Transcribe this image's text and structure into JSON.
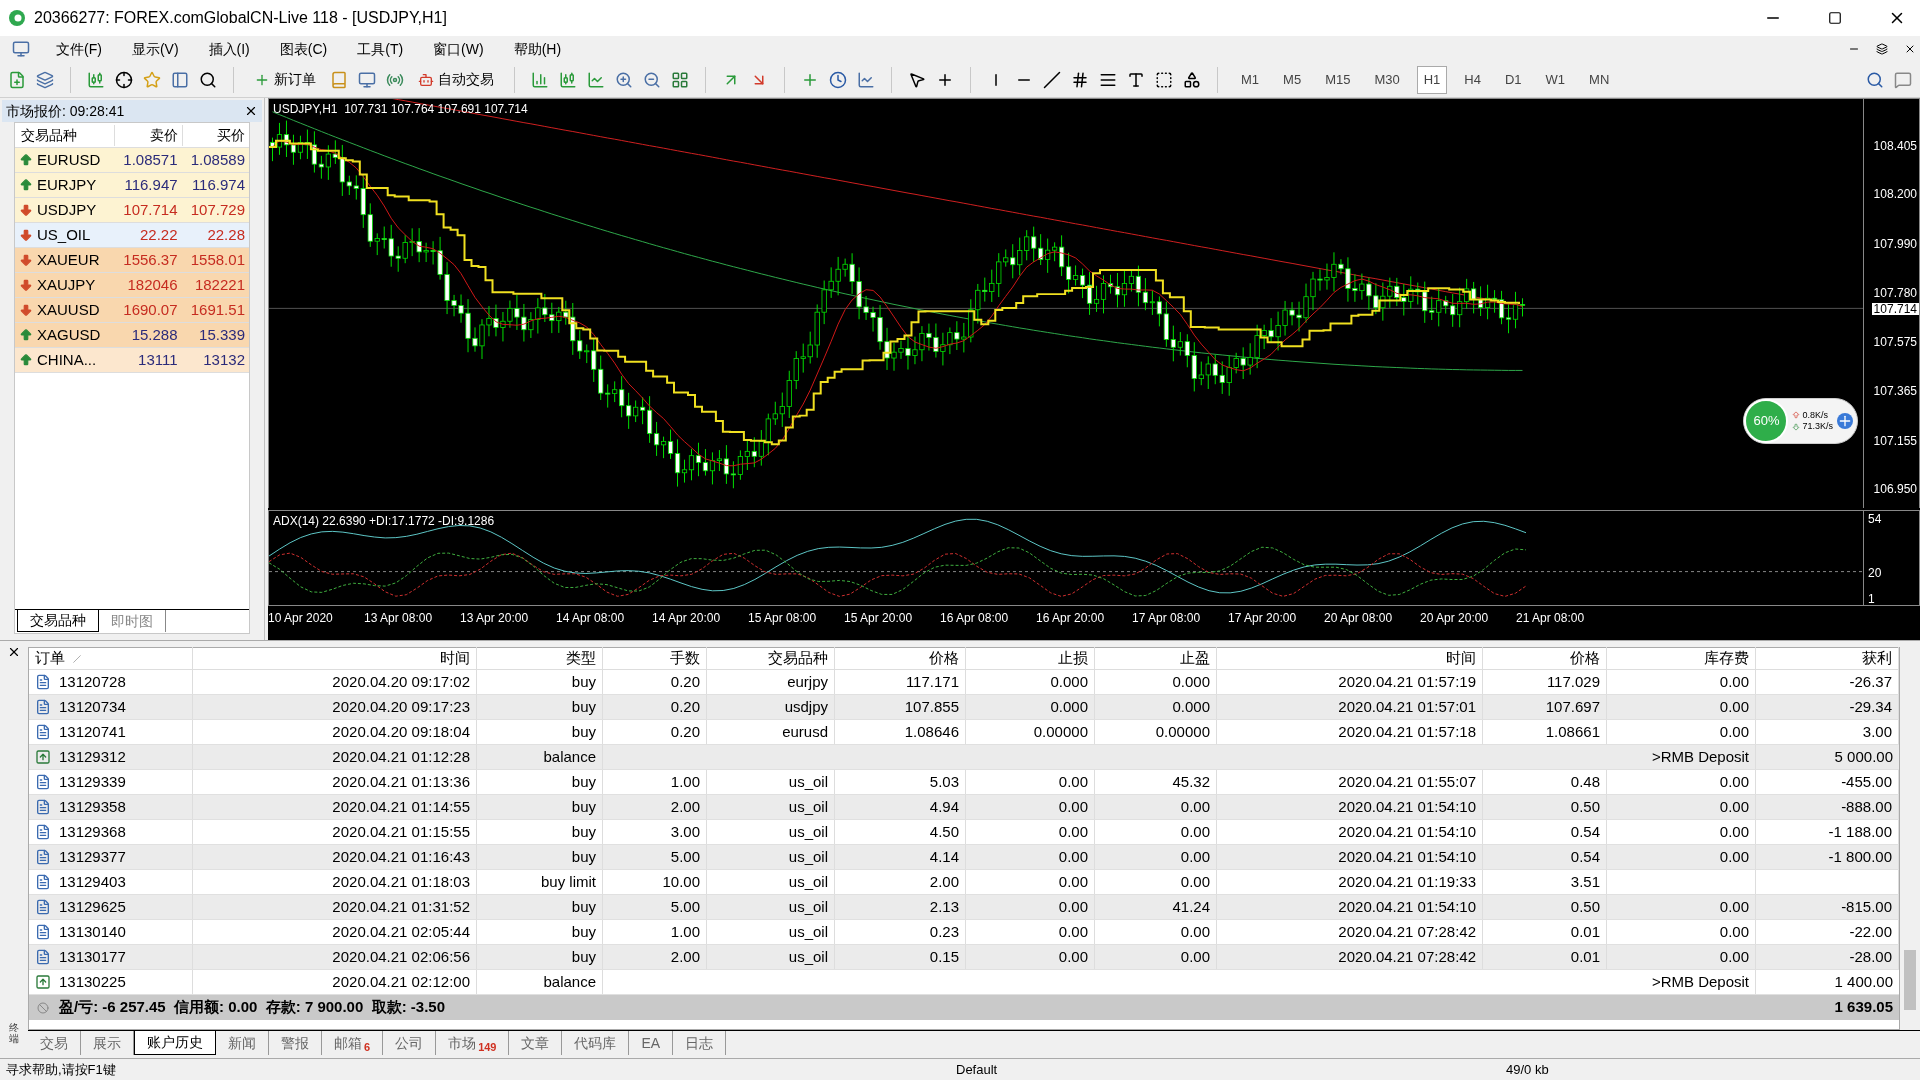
{
  "window": {
    "title": "20366277: FOREX.comGlobalCN-Live 118 - [USDJPY,H1]"
  },
  "menu": [
    "文件(F)",
    "显示(V)",
    "插入(I)",
    "图表(C)",
    "工具(T)",
    "窗口(W)",
    "帮助(H)"
  ],
  "toolbar": {
    "new_order": "新订单",
    "auto_trading": "自动交易",
    "timeframes": [
      {
        "label": "M1",
        "selected": false
      },
      {
        "label": "M5",
        "selected": false
      },
      {
        "label": "M15",
        "selected": false
      },
      {
        "label": "M30",
        "selected": false
      },
      {
        "label": "H1",
        "selected": true
      },
      {
        "label": "H4",
        "selected": false
      },
      {
        "label": "D1",
        "selected": false
      },
      {
        "label": "W1",
        "selected": false
      },
      {
        "label": "MN",
        "selected": false
      }
    ]
  },
  "market_watch": {
    "title": "市场报价: 09:28:41",
    "columns": [
      "交易品种",
      "卖价",
      "买价"
    ],
    "rows": [
      {
        "symbol": "EURUSD",
        "bid": "1.08571",
        "ask": "1.08589",
        "rising": true,
        "color": "#fdf3d2"
      },
      {
        "symbol": "EURJPY",
        "bid": "116.947",
        "ask": "116.974",
        "rising": true,
        "color": "#fdf3d2"
      },
      {
        "symbol": "USDJPY",
        "bid": "107.714",
        "ask": "107.729",
        "rising": false,
        "color": "#fdf3d2"
      },
      {
        "symbol": "US_OIL",
        "bid": "22.22",
        "ask": "22.28",
        "rising": false,
        "color": "#e8f1fb"
      },
      {
        "symbol": "XAUEUR",
        "bid": "1556.37",
        "ask": "1558.01",
        "rising": false,
        "color": "#f9d7ae"
      },
      {
        "symbol": "XAUJPY",
        "bid": "182046",
        "ask": "182221",
        "rising": false,
        "color": "#f9d7ae"
      },
      {
        "symbol": "XAUUSD",
        "bid": "1690.07",
        "ask": "1691.51",
        "rising": false,
        "color": "#f9d7ae"
      },
      {
        "symbol": "XAGUSD",
        "bid": "15.288",
        "ask": "15.339",
        "rising": true,
        "color": "#f9d7ae"
      },
      {
        "symbol": "CHINA...",
        "bid": "13111",
        "ask": "13132",
        "rising": true,
        "color": "#fce7ce"
      }
    ],
    "tabs": [
      {
        "label": "交易品种",
        "selected": true
      },
      {
        "label": "即时图",
        "selected": false
      }
    ]
  },
  "chart": {
    "header": "USDJPY,H1  107.731 107.764 107.691 107.714",
    "price_ticks": [
      "108.405",
      "108.200",
      "107.990",
      "107.780",
      "107.575",
      "107.365",
      "107.155",
      "106.950"
    ],
    "current_price": "107.714",
    "indicator": "ADX(14) 22.6390 +DI:17.1772 -DI:9.1286",
    "indicator_ticks": [
      "54",
      "20",
      "1"
    ],
    "time_ticks": [
      "10 Apr 2020",
      "13 Apr 08:00",
      "13 Apr 20:00",
      "14 Apr 08:00",
      "14 Apr 20:00",
      "15 Apr 08:00",
      "15 Apr 20:00",
      "16 Apr 08:00",
      "16 Apr 20:00",
      "17 Apr 08:00",
      "17 Apr 20:00",
      "20 Apr 08:00",
      "20 Apr 20:00",
      "21 Apr 08:00"
    ],
    "network": {
      "percent": "60%",
      "upload": "0.8K/s",
      "download": "71.3K/s"
    }
  },
  "history": {
    "columns": [
      "订单",
      "时间",
      "类型",
      "手数",
      "交易品种",
      "价格",
      "止损",
      "止盈",
      "时间",
      "价格",
      "库存费",
      "获利"
    ],
    "rows": [
      {
        "kind": "order",
        "cells": [
          "13120728",
          "2020.04.20 09:17:02",
          "buy",
          "0.20",
          "eurjpy",
          "117.171",
          "0.000",
          "0.000",
          "2020.04.21 01:57:19",
          "117.029",
          "0.00",
          "-26.37"
        ]
      },
      {
        "kind": "order",
        "cells": [
          "13120734",
          "2020.04.20 09:17:23",
          "buy",
          "0.20",
          "usdjpy",
          "107.855",
          "0.000",
          "0.000",
          "2020.04.21 01:57:01",
          "107.697",
          "0.00",
          "-29.34"
        ]
      },
      {
        "kind": "order",
        "cells": [
          "13120741",
          "2020.04.20 09:18:04",
          "buy",
          "0.20",
          "eurusd",
          "1.08646",
          "0.00000",
          "0.00000",
          "2020.04.21 01:57:18",
          "1.08661",
          "0.00",
          "3.00"
        ]
      },
      {
        "kind": "balance",
        "cells": [
          "13129312",
          "2020.04.21 01:12:28",
          "balance"
        ],
        "comment": ">RMB Deposit",
        "profit": "5 000.00"
      },
      {
        "kind": "order",
        "cells": [
          "13129339",
          "2020.04.21 01:13:36",
          "buy",
          "1.00",
          "us_oil",
          "5.03",
          "0.00",
          "45.32",
          "2020.04.21 01:55:07",
          "0.48",
          "0.00",
          "-455.00"
        ]
      },
      {
        "kind": "order",
        "cells": [
          "13129358",
          "2020.04.21 01:14:55",
          "buy",
          "2.00",
          "us_oil",
          "4.94",
          "0.00",
          "0.00",
          "2020.04.21 01:54:10",
          "0.50",
          "0.00",
          "-888.00"
        ]
      },
      {
        "kind": "order",
        "cells": [
          "13129368",
          "2020.04.21 01:15:55",
          "buy",
          "3.00",
          "us_oil",
          "4.50",
          "0.00",
          "0.00",
          "2020.04.21 01:54:10",
          "0.54",
          "0.00",
          "-1 188.00"
        ]
      },
      {
        "kind": "order",
        "cells": [
          "13129377",
          "2020.04.21 01:16:43",
          "buy",
          "5.00",
          "us_oil",
          "4.14",
          "0.00",
          "0.00",
          "2020.04.21 01:54:10",
          "0.54",
          "0.00",
          "-1 800.00"
        ]
      },
      {
        "kind": "order",
        "cells": [
          "13129403",
          "2020.04.21 01:18:03",
          "buy limit",
          "10.00",
          "us_oil",
          "2.00",
          "0.00",
          "0.00",
          "2020.04.21 01:19:33",
          "3.51"
        ]
      },
      {
        "kind": "order",
        "cells": [
          "13129625",
          "2020.04.21 01:31:52",
          "buy",
          "5.00",
          "us_oil",
          "2.13",
          "0.00",
          "41.24",
          "2020.04.21 01:54:10",
          "0.50",
          "0.00",
          "-815.00"
        ]
      },
      {
        "kind": "order",
        "cells": [
          "13130140",
          "2020.04.21 02:05:44",
          "buy",
          "1.00",
          "us_oil",
          "0.23",
          "0.00",
          "0.00",
          "2020.04.21 07:28:42",
          "0.01",
          "0.00",
          "-22.00"
        ]
      },
      {
        "kind": "order",
        "cells": [
          "13130177",
          "2020.04.21 02:06:56",
          "buy",
          "2.00",
          "us_oil",
          "0.15",
          "0.00",
          "0.00",
          "2020.04.21 07:28:42",
          "0.01",
          "0.00",
          "-28.00"
        ]
      },
      {
        "kind": "balance",
        "cells": [
          "13130225",
          "2020.04.21 02:12:00",
          "balance"
        ],
        "comment": ">RMB Deposit",
        "profit": "1 400.00"
      }
    ],
    "summary": {
      "text": "盈/亏: -6 257.45  信用额: 0.00  存款: 7 900.00  取款: -3.50",
      "total": "1 639.05"
    }
  },
  "terminal": {
    "label": "终端",
    "tabs": [
      {
        "label": "交易",
        "selected": false
      },
      {
        "label": "展示",
        "selected": false
      },
      {
        "label": "账户历史",
        "selected": true
      },
      {
        "label": "新闻",
        "selected": false
      },
      {
        "label": "警报",
        "selected": false
      },
      {
        "label": "邮箱",
        "badge": "6",
        "selected": false
      },
      {
        "label": "公司",
        "selected": false
      },
      {
        "label": "市场",
        "badge": "149",
        "selected": false
      },
      {
        "label": "文章",
        "selected": false
      },
      {
        "label": "代码库",
        "selected": false
      },
      {
        "label": "EA",
        "selected": false
      },
      {
        "label": "日志",
        "selected": false
      }
    ]
  },
  "status_bar": {
    "help": "寻求帮助,请按F1键",
    "profile": "Default",
    "traffic": "49/0 kb"
  }
}
